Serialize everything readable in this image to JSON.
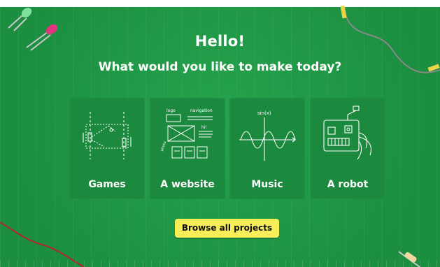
{
  "header": {
    "title": "Hello!",
    "subtitle": "What would you like to make today?"
  },
  "cards": [
    {
      "label": "Games",
      "icon": "game-sketch-icon"
    },
    {
      "label": "A website",
      "icon": "website-sketch-icon"
    },
    {
      "label": "Music",
      "icon": "sine-wave-icon"
    },
    {
      "label": "A robot",
      "icon": "robot-sketch-icon"
    }
  ],
  "sketch_text": {
    "website_logo": "logo",
    "website_nav": "navigation",
    "website_hi": "hi!",
    "website_photo": "photo",
    "music_sin": "sin(x)"
  },
  "browse_button": {
    "label": "Browse all projects"
  },
  "colors": {
    "background": "#1f9a45",
    "card": "#1b8a3e",
    "button": "#f7ee5a",
    "text": "#ffffff"
  }
}
